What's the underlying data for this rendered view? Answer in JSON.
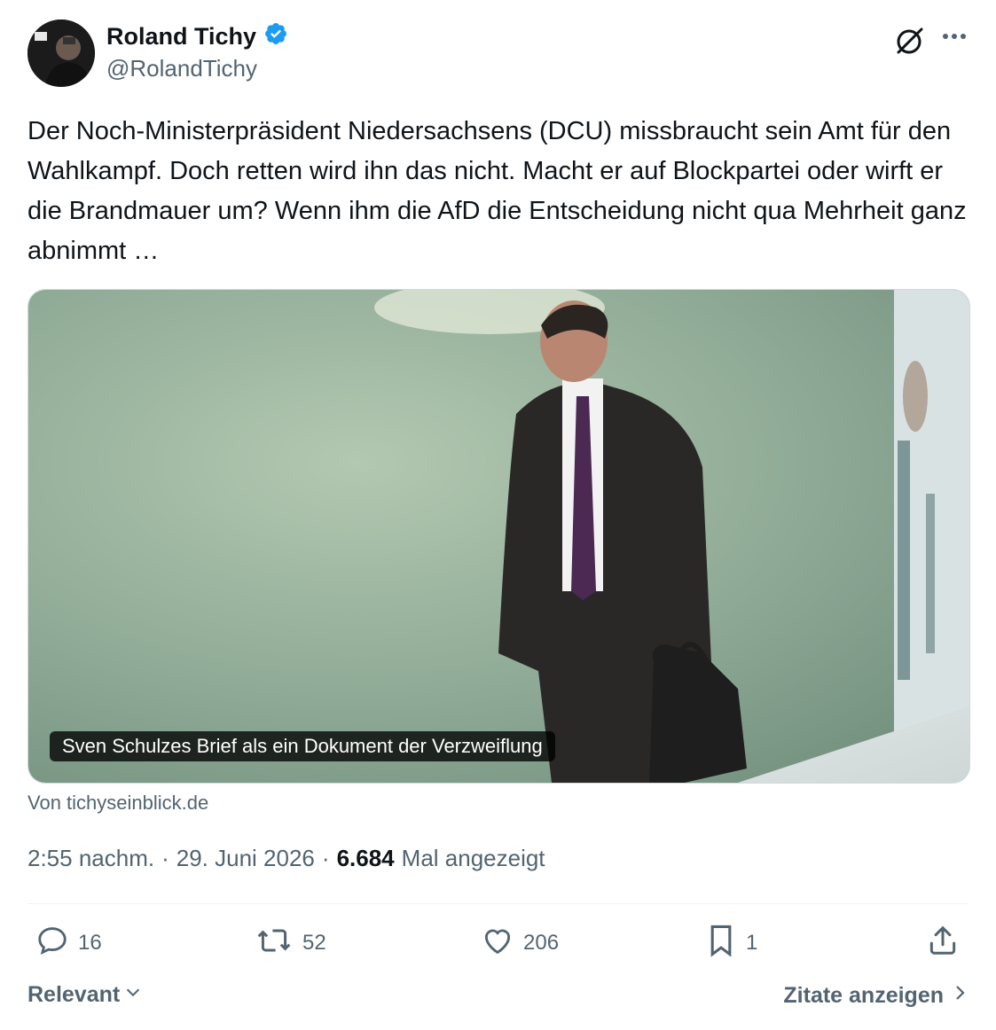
{
  "author": {
    "name": "Roland Tichy",
    "handle": "@RolandTichy",
    "verified": true,
    "verified_color": "#1d9bf0"
  },
  "tweet": {
    "text": "Der Noch-Ministerpräsident Niedersachsens  (DCU) missbraucht sein Amt für den Wahlkampf. Doch retten wird ihn das nicht. Macht er auf Blockpartei oder wirft er die Brandmauer um? Wenn ihm die AfD die Entscheidung nicht qua Mehrheit ganz abnimmt …"
  },
  "card": {
    "caption": "Sven Schulzes Brief als ein Dokument der Verzweiflung",
    "source": "Von tichyseinblick.de"
  },
  "meta": {
    "time": "2:55 nachm.",
    "separator1": "·",
    "date": "29. Juni 2026",
    "separator2": "·",
    "views": "6.684",
    "views_label": "Mal angezeigt"
  },
  "actions": {
    "replies": "16",
    "retweets": "52",
    "likes": "206",
    "bookmarks": "1"
  },
  "footer": {
    "sort_label": "Relevant",
    "quotes_label": "Zitate anzeigen"
  },
  "icons": [
    "grok-icon",
    "more-icon",
    "reply-icon",
    "retweet-icon",
    "like-icon",
    "bookmark-icon",
    "share-icon",
    "chevron-down-icon",
    "chevron-right-icon",
    "verified-badge-icon"
  ]
}
